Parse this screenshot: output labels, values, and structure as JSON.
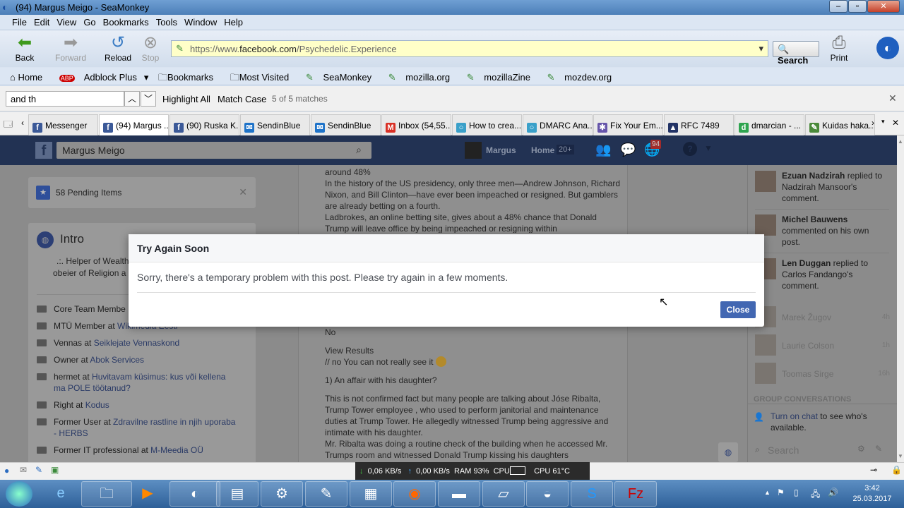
{
  "window": {
    "title": "(94) Margus Meigo - SeaMonkey"
  },
  "menu": [
    "File",
    "Edit",
    "View",
    "Go",
    "Bookmarks",
    "Tools",
    "Window",
    "Help"
  ],
  "nav": {
    "back": "Back",
    "forward": "Forward",
    "reload": "Reload",
    "stop": "Stop",
    "url_prefix": "https://www.",
    "url_domain": "facebook.com",
    "url_path": "/Psychedelic.Experience",
    "search": "Search",
    "print": "Print"
  },
  "bookmarks": [
    "Home",
    "Adblock Plus",
    "Bookmarks",
    "Most Visited",
    "SeaMonkey",
    "mozilla.org",
    "mozillaZine",
    "mozdev.org"
  ],
  "find": {
    "value": "and th",
    "highlight_all": "Highlight All",
    "match_case": "Match Case",
    "status": "5 of 5 matches"
  },
  "tabs": [
    {
      "label": "Messenger",
      "color": "#3b5998",
      "icon": "f"
    },
    {
      "label": "(94) Margus ...",
      "color": "#3b5998",
      "icon": "f",
      "active": true
    },
    {
      "label": "(90) Ruska K...",
      "color": "#3b5998",
      "icon": "f"
    },
    {
      "label": "SendinBlue",
      "color": "#1e73c9",
      "icon": "✉"
    },
    {
      "label": "SendinBlue",
      "color": "#1e73c9",
      "icon": "✉"
    },
    {
      "label": "Inbox (54,55...",
      "color": "#d93025",
      "icon": "M"
    },
    {
      "label": "How to crea...",
      "color": "#3aa0c9",
      "icon": "○"
    },
    {
      "label": "DMARC Ana...",
      "color": "#3aa0c9",
      "icon": "○"
    },
    {
      "label": "Fix Your Em...",
      "color": "#6655aa",
      "icon": "✱"
    },
    {
      "label": "RFC 7489",
      "color": "#223366",
      "icon": "▲"
    },
    {
      "label": "dmarcian - ...",
      "color": "#2ea44f",
      "icon": "d"
    },
    {
      "label": "Kuidas haka...",
      "color": "#4a8a3a",
      "icon": "✎"
    }
  ],
  "fb": {
    "search": "Margus Meigo",
    "user": "Margus",
    "home": "Home",
    "home_badge": "20+",
    "notif_badge": "94"
  },
  "left": {
    "pending": "58 Pending Items",
    "intro_title": "Intro",
    "bio1": ".:. Helper of Wealth",
    "bio2": "obeier of Religion a",
    "items": [
      {
        "pre": "Core Team Membe",
        "link": ""
      },
      {
        "pre": "MTÜ Member at ",
        "link": "Wikimedia Eesti"
      },
      {
        "pre": "Vennas at ",
        "link": "Seiklejate Vennaskond"
      },
      {
        "pre": "Owner at ",
        "link": "Abok Services"
      },
      {
        "pre": "hermet at ",
        "link": "Huvitavam küsimus: kus või kellena ma POLE töötanud?"
      },
      {
        "pre": "Right at ",
        "link": "Kodus"
      },
      {
        "pre": "Former User at ",
        "link": "Zdravilne rastline in njih uporaba - HERBS"
      },
      {
        "pre": "Former IT professional at ",
        "link": "M-Meedia OÜ"
      }
    ]
  },
  "post": {
    "p1": "around 48%\nIn the history of the US presidency, only three men—Andrew Johnson, Richard Nixon, and Bill Clinton—have ever been impeached or resigned. But gamblers are already betting on a fourth.\nLadbrokes, an online betting site, gives about a 48% chance that Donald Trump will leave office by being impeached or resigning within",
    "no": "No",
    "view_results": "View Results",
    "no_see": "// no You can not really see it",
    "q1": "1) An affair with his daughter?",
    "p2": "This is not confirmed fact but many people are talking about Jóse Ribalta, Trump Tower employee , who used to perform janitorial and maintenance duties at Trump Tower. He allegedly witnessed Trump being aggressive and intimate with his daughter.\nMr. Ribalta was doing a routine check of the building when he accessed Mr. Trumps room and witnessed Donald Trump kissing his daughters"
  },
  "right": {
    "notifs": [
      {
        "name": "Ezuan Nadzirah",
        "text": " replied to Nadzirah Mansoor's comment."
      },
      {
        "name": "Michel Bauwens",
        "text": " commented on his own post."
      },
      {
        "name": "Len Duggan",
        "text": " replied to Carlos Fandango's comment."
      }
    ],
    "chats": [
      {
        "name": "Marek Žugov",
        "time": "4h"
      },
      {
        "name": "Laurie Colson",
        "time": "1h"
      },
      {
        "name": "Toomas Sirge",
        "time": "16h"
      }
    ],
    "group_header": "GROUP CONVERSATIONS",
    "turn_on_link": "Turn on chat",
    "turn_on_rest": " to see who's available.",
    "search": "Search"
  },
  "dialog": {
    "title": "Try Again Soon",
    "body": "Sorry, there's a temporary problem with this post. Please try again in a few moments.",
    "close": "Close"
  },
  "status": {
    "down": "0,06 KB/s",
    "up": "0,00 KB/s",
    "ram": "RAM 93%",
    "cpu": "CPU",
    "cpu_temp": "CPU 61°C"
  },
  "clock": {
    "time": "3:42",
    "date": "25.03.2017"
  }
}
